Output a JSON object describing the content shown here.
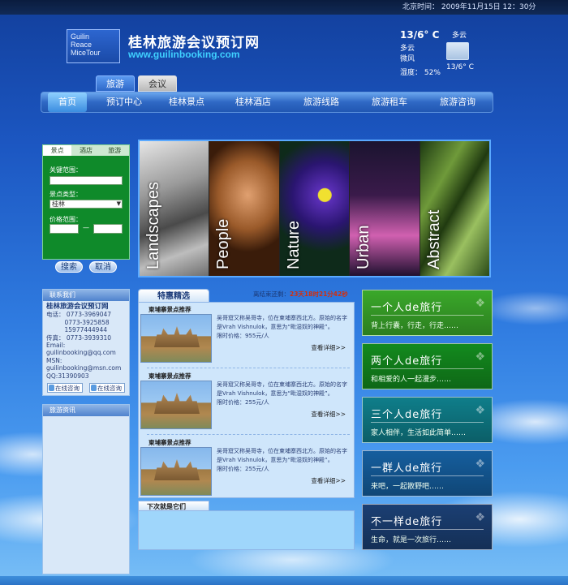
{
  "topbar": {
    "datetime": "北京时间： 2009年11月15日 12：30分"
  },
  "header": {
    "logo_lines": [
      "Guilin",
      "Reace",
      "MiceTour"
    ],
    "title": "桂林旅游会议预订网",
    "url": "www.guilinbooking.com"
  },
  "weather": {
    "temp": "13/6° C",
    "cloud_label": "多云",
    "status": "多云",
    "wind": "微风",
    "humidity": "湿度： 52%",
    "temp_small": "13/6° C",
    "icon": "cloudy-icon"
  },
  "tabs": [
    "旅游",
    "会议"
  ],
  "nav": [
    "首页",
    "预订中心",
    "桂林景点",
    "桂林酒店",
    "旅游线路",
    "旅游租车",
    "旅游咨询"
  ],
  "search": {
    "tabs": [
      "景点",
      "酒店",
      "旅游"
    ],
    "keyword_label": "关键范围：",
    "type_label": "景点类型：",
    "type_value": "桂林",
    "price_label": "价格范围：",
    "dash": "—",
    "search_button": "搜索",
    "cancel_button": "取消"
  },
  "banner": [
    "Landscapes",
    "People",
    "Nature",
    "Urban",
    "Abstract"
  ],
  "contact": {
    "header": "联系我们",
    "name": "桂林旅游会议预订网",
    "lines": [
      "电话： 0773-3969047",
      "　　　0773-3925858",
      "　　　15977444944",
      "传真： 0773-3939310",
      "Email:",
      "guilinbooking@qq.com",
      "MSN:",
      "guilinbooking@msn.com",
      "QQ:31390903"
    ],
    "btn1": "在线咨询",
    "btn2": "在线咨询"
  },
  "news": {
    "header": "旅游资讯"
  },
  "specials": {
    "title": "特惠精选",
    "countdown_label": "离结束还剩：",
    "countdown_value": "23天18时21分42秒",
    "items": [
      {
        "head": "柬埔寨景点推荐",
        "desc": "吴哥窟又称吴哥寺，位在柬埔寨西北方。原始的名字是Vrah Vishnulok，意思为“毗湿奴的神殿”。",
        "price": "限时价格：955元/人",
        "more": "查看详细>>"
      },
      {
        "head": "柬埔寨景点推荐",
        "desc": "吴哥窟又称吴哥寺，位在柬埔寨西北方。原始的名字是Vrah Vishnulok，意思为“毗湿奴的神殿”。",
        "price": "限时价格：255元/人",
        "more": "查看详细>>"
      },
      {
        "head": "柬埔寨景点推荐",
        "desc": "吴哥窟又称吴哥寺，位在柬埔寨西北方。原始的名字是Vrah Vishnulok，意思为“毗湿奴的神殿”。",
        "price": "限时价格：255元/人",
        "more": "查看详细>>"
      }
    ],
    "next_title": "下次就是它们"
  },
  "promos": [
    {
      "title": "一个人de旅行",
      "sub": "背上行囊，行走，行走……",
      "color": "#3aa82a"
    },
    {
      "title": "两个人de旅行",
      "sub": "和相爱的人一起漫步……",
      "color": "#138a1e"
    },
    {
      "title": "三个人de旅行",
      "sub": "家人相伴，生活如此简单……",
      "color": "#0f7e8a"
    },
    {
      "title": "一群人de旅行",
      "sub": "来吧，一起散野吧……",
      "color": "#155e9e"
    },
    {
      "title": "不一样de旅行",
      "sub": "生命，就是一次旅行……",
      "color": "#1b3f73"
    }
  ]
}
